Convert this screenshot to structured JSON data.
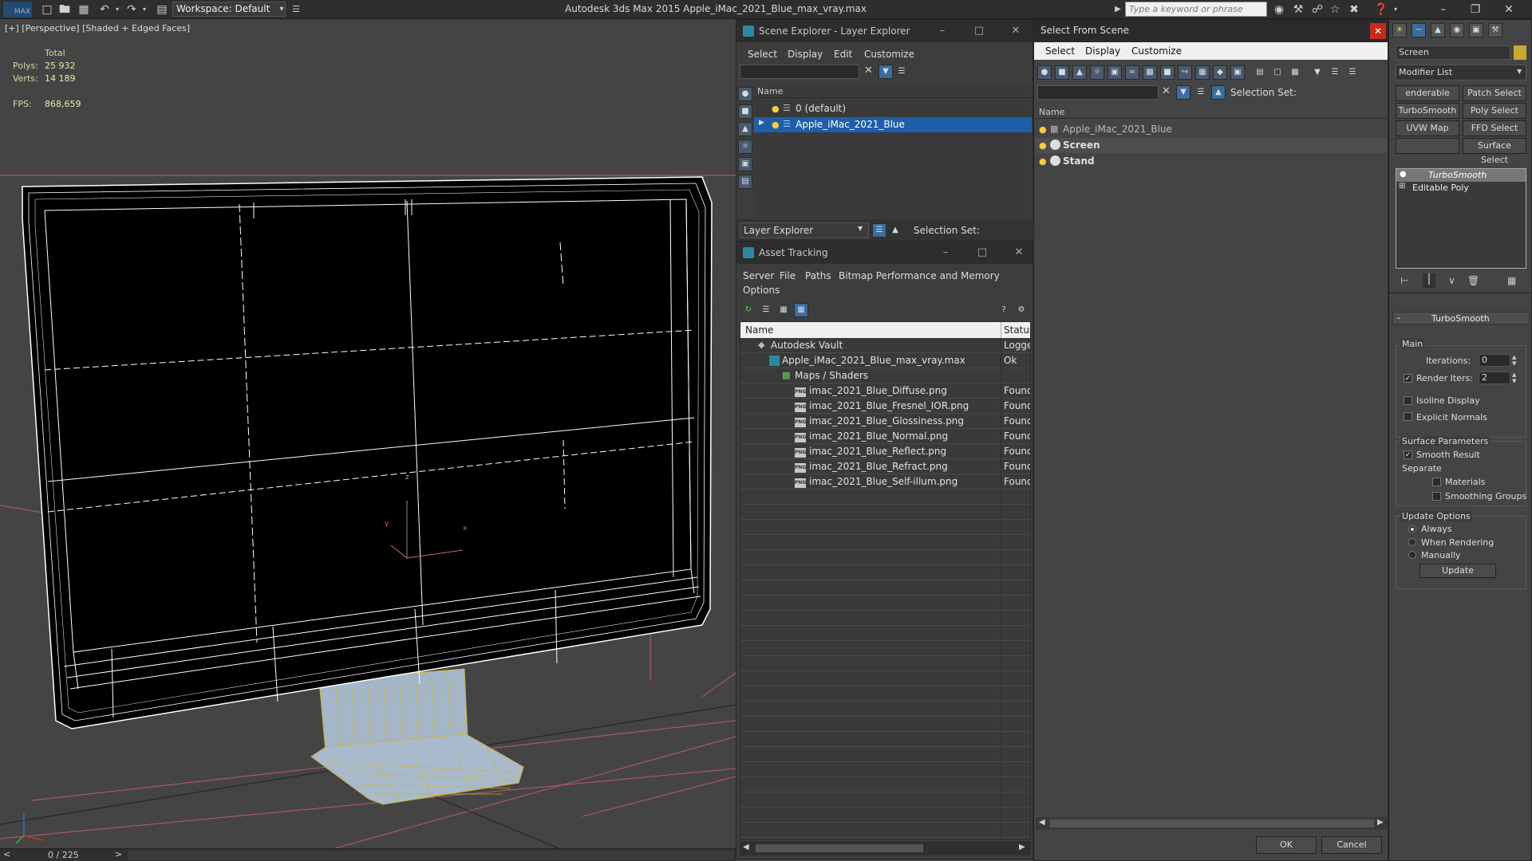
{
  "titlebar": {
    "logo": "MAX",
    "workspace_label": "Workspace: Default",
    "app_title": "Autodesk 3ds Max  2015     Apple_iMac_2021_Blue_max_vray.max",
    "search_placeholder": "Type a keyword or phrase"
  },
  "viewport": {
    "label": "[+] [Perspective] [Shaded + Edged Faces]",
    "stats": {
      "total_label": "Total",
      "polys_label": "Polys:",
      "polys_value": "25 932",
      "verts_label": "Verts:",
      "verts_value": "14 189",
      "fps_label": "FPS:",
      "fps_value": "868,659"
    },
    "axis_labels": {
      "z": "z",
      "y": "y",
      "x": "x"
    },
    "colors": {
      "background": "#444444",
      "screen": "#000000",
      "wire": "#ffffff",
      "stand": "#9fb3c8",
      "stand_wire": "#c9b53a",
      "grid": "#d9607a"
    }
  },
  "timebar": {
    "frame_label": "0 / 225",
    "prev": "<",
    "next": ">"
  },
  "scene_explorer": {
    "title": "Scene Explorer - Layer Explorer",
    "menu": [
      "Select",
      "Display",
      "Edit",
      "Customize"
    ],
    "column_name": "Name",
    "rows": [
      {
        "label": "0 (default)"
      },
      {
        "label": "Apple_iMac_2021_Blue"
      }
    ],
    "footer_dropdown": "Layer Explorer",
    "footer_selection_set": "Selection Set:"
  },
  "asset_tracking": {
    "title": "Asset Tracking",
    "menu": [
      "Server",
      "File",
      "Paths",
      "Bitmap Performance and Memory",
      "Options"
    ],
    "columns": [
      "Name",
      "Status"
    ],
    "rows": [
      {
        "name": "Autodesk Vault",
        "status": "Logged"
      },
      {
        "name": "Apple_iMac_2021_Blue_max_vray.max",
        "status": "Ok"
      },
      {
        "name": "Maps / Shaders",
        "status": ""
      },
      {
        "name": "imac_2021_Blue_Diffuse.png",
        "status": "Found"
      },
      {
        "name": "imac_2021_Blue_Fresnel_IOR.png",
        "status": "Found"
      },
      {
        "name": "imac_2021_Blue_Glossiness.png",
        "status": "Found"
      },
      {
        "name": "imac_2021_Blue_Normal.png",
        "status": "Found"
      },
      {
        "name": "imac_2021_Blue_Reflect.png",
        "status": "Found"
      },
      {
        "name": "imac_2021_Blue_Refract.png",
        "status": "Found"
      },
      {
        "name": "imac_2021_Blue_Self-illum.png",
        "status": "Found"
      }
    ],
    "png_badge": "PNG"
  },
  "select_from_scene": {
    "title": "Select From Scene",
    "menu": [
      "Select",
      "Display",
      "Customize"
    ],
    "selection_set_label": "Selection Set:",
    "column_name": "Name",
    "rows": [
      {
        "label": "Apple_iMac_2021_Blue"
      },
      {
        "label": "Screen"
      },
      {
        "label": "Stand"
      }
    ],
    "ok_label": "OK",
    "cancel_label": "Cancel"
  },
  "command_panel": {
    "object_name": "Screen",
    "modifier_list": "Modifier List",
    "modifier_buttons": [
      "enderable Spli",
      "Patch Select",
      "TurboSmooth",
      "Poly Select",
      "UVW Map",
      "FFD Select",
      "",
      "Surface Select"
    ],
    "stack": [
      "TurboSmooth",
      "Editable Poly"
    ],
    "rollout_title": "TurboSmooth",
    "main_label": "Main",
    "iterations_label": "Iterations:",
    "iterations_value": "0",
    "render_iters_label": "Render Iters:",
    "render_iters_value": "2",
    "isoline_label": "Isoline Display",
    "explicit_normals_label": "Explicit Normals",
    "surface_params_label": "Surface Parameters",
    "smooth_result_label": "Smooth Result",
    "separate_label": "Separate",
    "materials_label": "Materials",
    "smoothing_groups_label": "Smoothing Groups",
    "update_options_label": "Update Options",
    "always_label": "Always",
    "when_rendering_label": "When Rendering",
    "manually_label": "Manually",
    "update_button": "Update"
  }
}
